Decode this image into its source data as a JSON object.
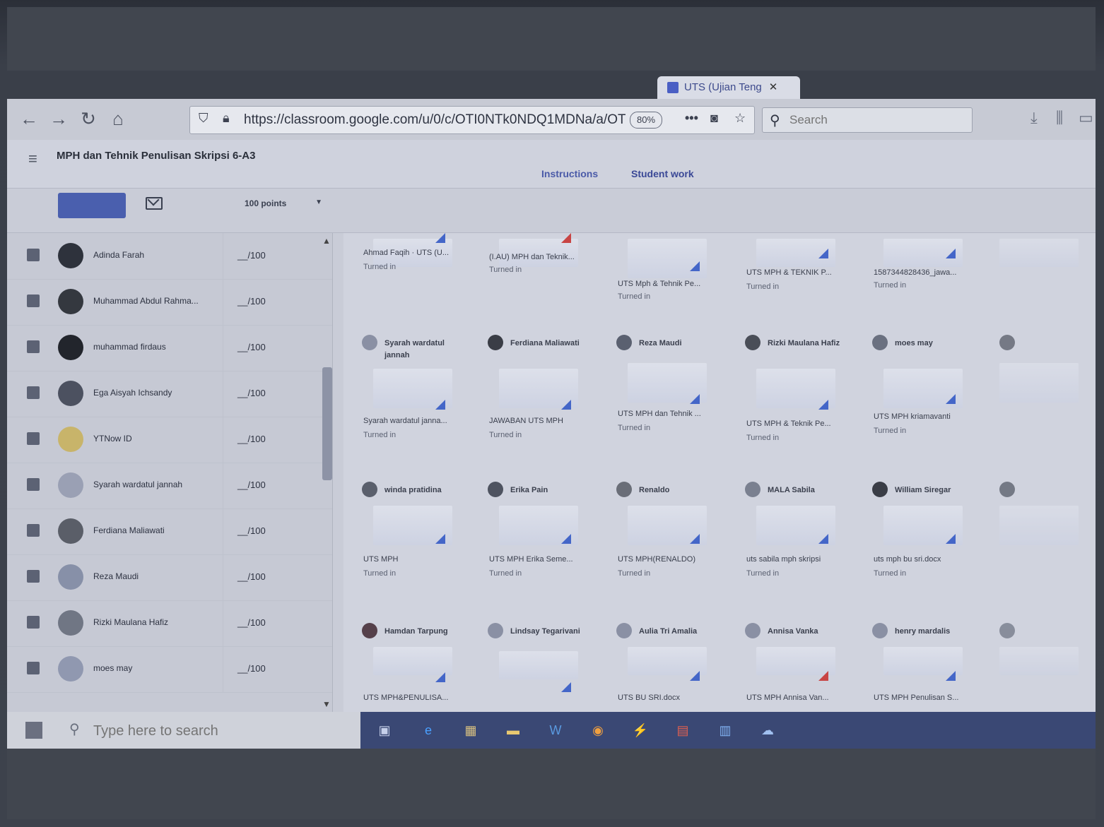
{
  "browser": {
    "active_tab": {
      "title": "UTS (Ujian Teng",
      "close": "✕"
    },
    "url": "https://classroom.google.com/u/0/c/OTI0NTk0NDQ1MDNa/a/OTI0N",
    "zoom": "80%",
    "search_placeholder": "Search"
  },
  "course": {
    "title": "MPH dan Tehnik Penulisan Skripsi 6-A3",
    "page_tabs": [
      "Instructions",
      "Student work"
    ]
  },
  "actions": {
    "points": "100 points"
  },
  "roster": [
    {
      "name": "Adinda Farah",
      "grade": "__/100"
    },
    {
      "name": "Muhammad Abdul Rahma...",
      "grade": "__/100"
    },
    {
      "name": "muhammad firdaus",
      "grade": "__/100"
    },
    {
      "name": "Ega Aisyah Ichsandy",
      "grade": "__/100"
    },
    {
      "name": "YTNow ID",
      "grade": "__/100"
    },
    {
      "name": "Syarah wardatul jannah",
      "grade": "__/100"
    },
    {
      "name": "Ferdiana Maliawati",
      "grade": "__/100"
    },
    {
      "name": "Reza Maudi",
      "grade": "__/100"
    },
    {
      "name": "Rizki Maulana Hafiz",
      "grade": "__/100"
    },
    {
      "name": "moes may",
      "grade": "__/100"
    }
  ],
  "cards": [
    {
      "student": "",
      "file": "Ahmad Faqih · UTS (U...",
      "status": "Turned in"
    },
    {
      "student": "",
      "file": "(I.AU) MPH dan Teknik...",
      "status": "Turned in"
    },
    {
      "student": "",
      "file": "UTS Mph & Tehnik Pe...",
      "status": "Turned in"
    },
    {
      "student": "",
      "file": "UTS MPH & TEKNIK P...",
      "status": "Turned in"
    },
    {
      "student": "",
      "file": "1587344828436_jawa...",
      "status": "Turned in"
    },
    {
      "student": "Syarah wardatul jannah",
      "file": "Syarah wardatul janna...",
      "status": "Turned in"
    },
    {
      "student": "Ferdiana Maliawati",
      "file": "JAWABAN UTS MPH",
      "status": "Turned in"
    },
    {
      "student": "Reza Maudi",
      "file": "UTS MPH dan Tehnik ...",
      "status": "Turned in"
    },
    {
      "student": "Rizki Maulana Hafiz",
      "file": "UTS MPH & Teknik Pe...",
      "status": "Turned in"
    },
    {
      "student": "moes may",
      "file": "UTS MPH kriamavanti",
      "status": "Turned in"
    },
    {
      "student": "winda pratidina",
      "file": "UTS MPH",
      "status": "Turned in"
    },
    {
      "student": "Erika Pain",
      "file": "UTS MPH Erika Seme...",
      "status": "Turned in"
    },
    {
      "student": "Renaldo",
      "file": "UTS MPH(RENALDO)",
      "status": "Turned in"
    },
    {
      "student": "MALA Sabila",
      "file": "uts sabila mph skripsi",
      "status": "Turned in"
    },
    {
      "student": "William Siregar",
      "file": "uts mph bu sri.docx",
      "status": "Turned in"
    },
    {
      "student": "Hamdan Tarpung",
      "file": "UTS MPH&PENULISA...",
      "status": ""
    },
    {
      "student": "Lindsay Tegarivani",
      "file": "",
      "status": ""
    },
    {
      "student": "Aulia Tri Amalia",
      "file": "UTS BU SRI.docx",
      "status": ""
    },
    {
      "student": "Annisa Vanka",
      "file": "UTS MPH Annisa Van...",
      "status": ""
    },
    {
      "student": "henry mardalis",
      "file": "UTS MPH Penulisan S...",
      "status": ""
    }
  ],
  "taskbar": {
    "search_placeholder": "Type here to search"
  },
  "colors": {
    "accent": "#3a4896",
    "doc_blue": "#4466c8",
    "doc_red": "#c84444"
  }
}
